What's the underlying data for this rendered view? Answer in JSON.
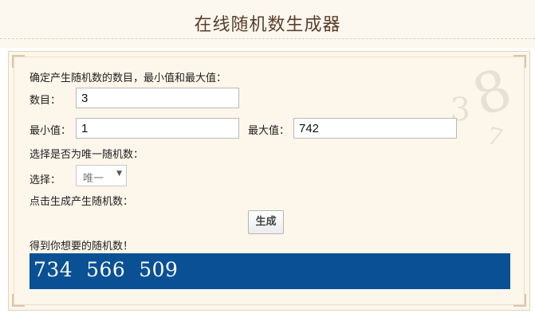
{
  "header": {
    "title": "在线随机数生成器"
  },
  "form": {
    "intro_label": "确定产生随机数的数目，最小值和最大值：",
    "count_label": "数目：",
    "count_value": "3",
    "min_label": "最小值：",
    "min_value": "1",
    "max_label": "最大值：",
    "max_value": "742",
    "unique_prompt": "选择是否为唯一随机数：",
    "select_label": "选择：",
    "select_value": "唯一",
    "generate_prompt": "点击生成产生随机数：",
    "generate_button": "生成",
    "result_label": "得到你想要的随机数！",
    "result_value": "734  566  509"
  },
  "colors": {
    "result_bg": "#0a5094",
    "panel_bg": "#fdf6ea",
    "title": "#5a3e2b"
  }
}
